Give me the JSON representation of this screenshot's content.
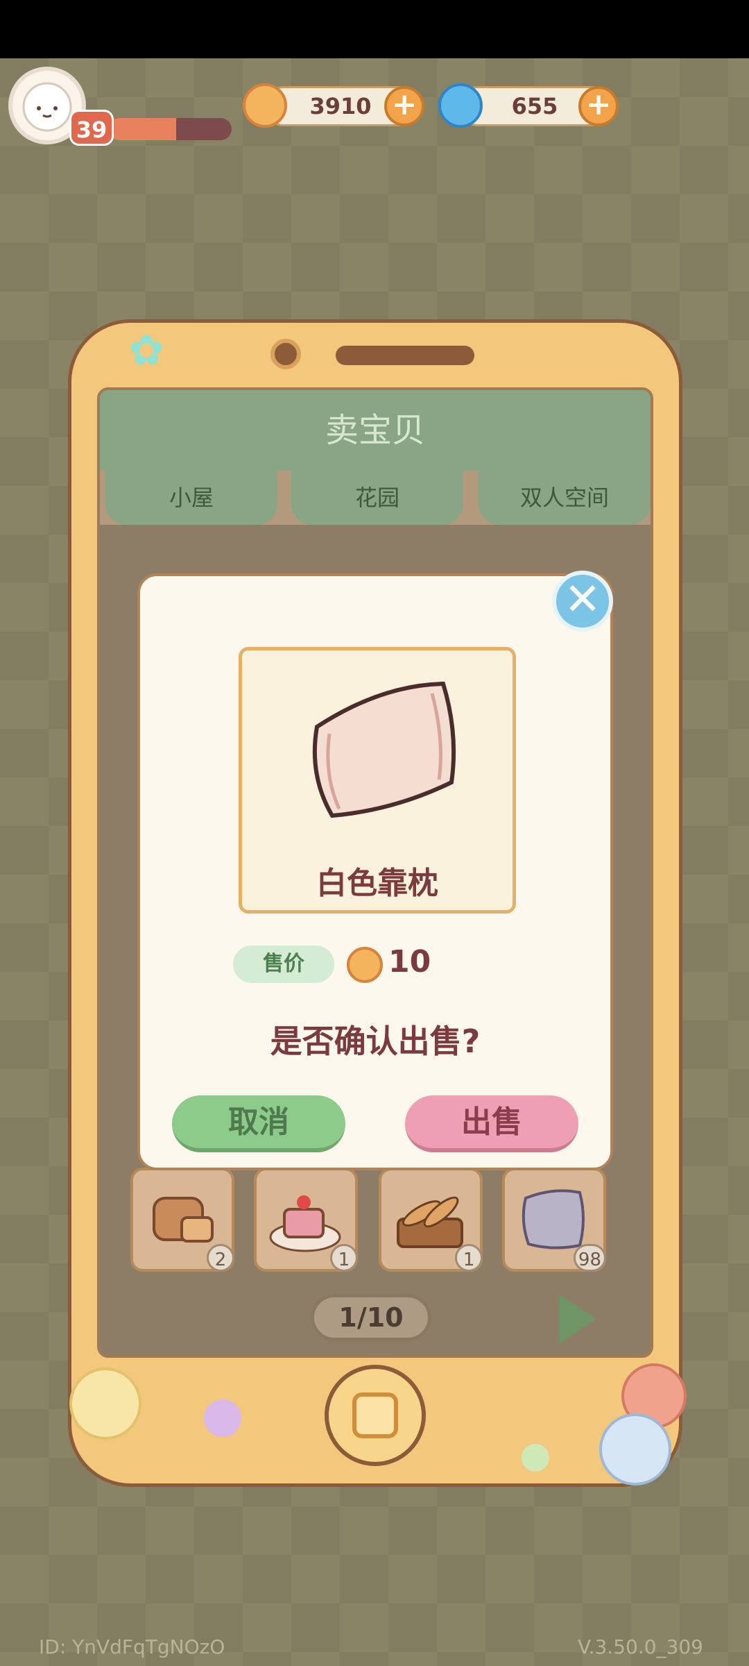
{
  "hud": {
    "level": "39",
    "xp_fraction": 0.55,
    "coins": "3910",
    "gems": "655"
  },
  "phone_screen": {
    "title": "卖宝贝",
    "tabs": [
      "小屋",
      "花园",
      "双人空间"
    ],
    "items": [
      {
        "icon": "bread-icon",
        "count": "2"
      },
      {
        "icon": "cake-icon",
        "count": "1"
      },
      {
        "icon": "baguette-basket-icon",
        "count": "1"
      },
      {
        "icon": "pillow-icon",
        "count": "98"
      }
    ],
    "page": "1/10"
  },
  "dialog": {
    "item_name": "白色靠枕",
    "price_label": "售价",
    "price_value": "10",
    "confirm_question": "是否确认出售?",
    "cancel_label": "取消",
    "sell_label": "出售",
    "close_symbol": "✕"
  },
  "footer": {
    "id": "ID: YnVdFqTgNOzO",
    "version": "V.3.50.0_309"
  },
  "colors": {
    "accent_green": "#8ccb8a",
    "accent_pink": "#ef9fb4",
    "phone_body": "#f3c77c",
    "text_brown": "#7b3b3e"
  }
}
